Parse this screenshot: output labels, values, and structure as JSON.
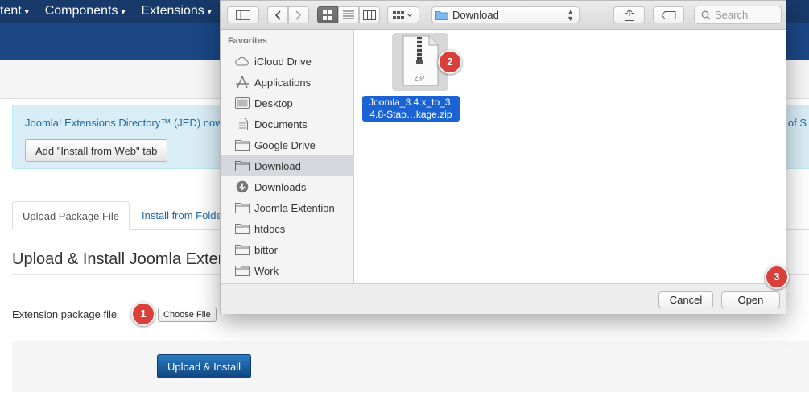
{
  "joomla": {
    "top_menu": [
      {
        "label": "tent",
        "caret": "▾"
      },
      {
        "label": "Components",
        "caret": "▾"
      },
      {
        "label": "Extensions",
        "caret": "▾"
      }
    ],
    "jed_message": "Joomla! Extensions Directory™ (JED) now",
    "jed_message_tail": "s of S",
    "jed_button": "Add \"Install from Web\" tab",
    "tabs": [
      {
        "label": "Upload Package File",
        "active": true
      },
      {
        "label": "Install from Folde",
        "active": false
      }
    ],
    "section_title": "Upload & Install Joomla Exten",
    "extension_label": "Extension package file",
    "choose_button": "Choose File",
    "upload_button": "Upload & Install"
  },
  "badges": [
    "1",
    "2",
    "3"
  ],
  "dialog": {
    "path_popup": "Download",
    "search_placeholder": "Search",
    "view_mode": "icons",
    "sidebar_heading": "Favorites",
    "sidebar_items": [
      {
        "label": "iCloud Drive",
        "icon": "cloud-icon",
        "selected": false
      },
      {
        "label": "Applications",
        "icon": "applications-icon",
        "selected": false
      },
      {
        "label": "Desktop",
        "icon": "desktop-icon",
        "selected": false
      },
      {
        "label": "Documents",
        "icon": "documents-icon",
        "selected": false
      },
      {
        "label": "Google Drive",
        "icon": "folder-icon",
        "selected": false
      },
      {
        "label": "Download",
        "icon": "folder-icon",
        "selected": true
      },
      {
        "label": "Downloads",
        "icon": "downloads-icon",
        "selected": false
      },
      {
        "label": "Joomla Extention",
        "icon": "folder-icon",
        "selected": false
      },
      {
        "label": "htdocs",
        "icon": "folder-icon",
        "selected": false
      },
      {
        "label": "bittor",
        "icon": "folder-icon",
        "selected": false
      },
      {
        "label": "Work",
        "icon": "folder-icon",
        "selected": false
      }
    ],
    "file": {
      "name_line1": "Joomla_3.4.x_to_3.",
      "name_line2": "4.8-Stab…kage.zip",
      "type_label": "ZIP"
    },
    "cancel_button": "Cancel",
    "open_button": "Open"
  },
  "colors": {
    "joomla_nav": "#183a6b",
    "joomla_subnav": "#1b4785",
    "badge_red": "#d9403a",
    "selection_blue": "#1b63d3"
  }
}
